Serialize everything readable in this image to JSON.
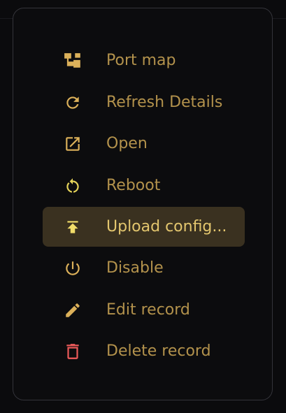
{
  "menu": {
    "items": [
      {
        "label": "Port map",
        "icon": "port-map-icon",
        "color": "#dcb15a"
      },
      {
        "label": "Refresh Details",
        "icon": "refresh-icon",
        "color": "#dcb15a"
      },
      {
        "label": "Open",
        "icon": "open-external-icon",
        "color": "#dcb15a"
      },
      {
        "label": "Reboot",
        "icon": "reboot-icon",
        "color": "#e6d45a"
      },
      {
        "label": "Upload config...",
        "icon": "upload-icon",
        "color": "#f1dd6a",
        "highlighted": true
      },
      {
        "label": "Disable",
        "icon": "power-icon",
        "color": "#dcb15a"
      },
      {
        "label": "Edit record",
        "icon": "pencil-icon",
        "color": "#dcb15a"
      },
      {
        "label": "Delete record",
        "icon": "trash-icon",
        "color": "#ef5b5b"
      }
    ]
  },
  "colors": {
    "label": "#b3924c",
    "label_highlighted": "#e3c66e",
    "highlight_background": "#3a3120",
    "menu_border": "#34343a",
    "menu_background": "#0c0c0e"
  }
}
